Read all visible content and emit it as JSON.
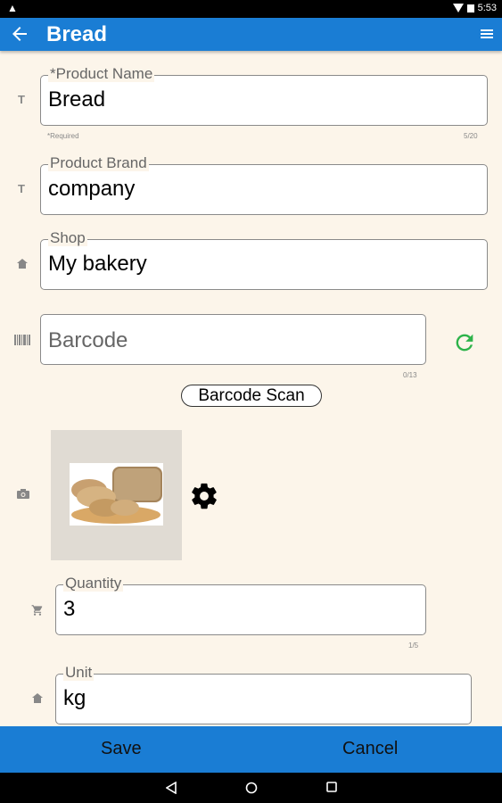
{
  "status_bar": {
    "time": "5:53"
  },
  "app_bar": {
    "title": "Bread"
  },
  "form": {
    "product_name": {
      "label": "*Product Name",
      "value": "Bread",
      "helper_left": "*Required",
      "counter": "5/20"
    },
    "product_brand": {
      "label": "Product Brand",
      "value": "company"
    },
    "shop": {
      "label": "Shop",
      "value": "My bakery"
    },
    "barcode": {
      "placeholder": "Barcode",
      "counter": "0/13"
    },
    "barcode_scan_label": "Barcode Scan",
    "quantity": {
      "label": "Quantity",
      "value": "3",
      "counter": "1/5"
    },
    "unit": {
      "label": "Unit",
      "value": "kg"
    }
  },
  "field_icons": {
    "text_icon": "T"
  },
  "bottom_bar": {
    "save_label": "Save",
    "cancel_label": "Cancel"
  },
  "colors": {
    "accent": "#1a7dd4",
    "background": "#fcf5ea",
    "refresh": "#2db34a"
  },
  "icons": [
    "back-arrow-icon",
    "menu-icon",
    "text-icon",
    "home-icon",
    "barcode-icon",
    "refresh-icon",
    "camera-icon",
    "gear-icon",
    "cart-icon",
    "nav-back-icon",
    "nav-home-icon",
    "nav-recents-icon"
  ]
}
